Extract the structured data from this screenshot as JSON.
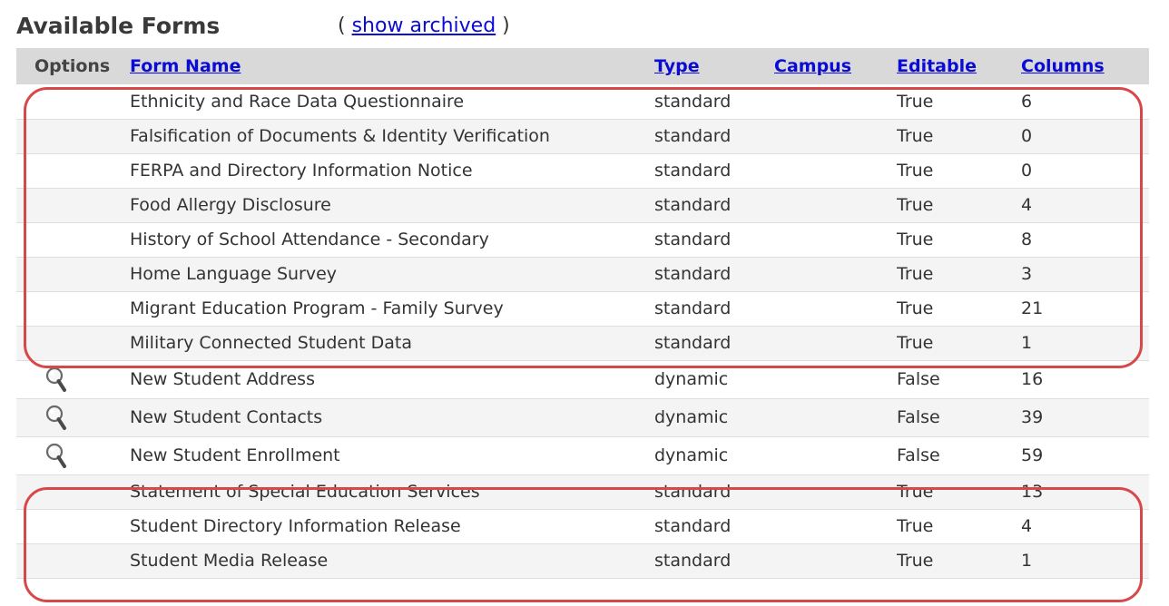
{
  "header": {
    "title": "Available Forms",
    "archived_open": "(",
    "archived_link": "show archived",
    "archived_close": ")"
  },
  "columns": [
    "Options",
    "Form Name",
    "Type",
    "Campus",
    "Editable",
    "Columns"
  ],
  "rows": [
    {
      "name": "Ethnicity and Race Data Questionnaire",
      "type": "standard",
      "campus": "",
      "editable": "True",
      "columns": "6",
      "icon": ""
    },
    {
      "name": "Falsification of Documents & Identity Verification",
      "type": "standard",
      "campus": "",
      "editable": "True",
      "columns": "0",
      "icon": ""
    },
    {
      "name": "FERPA and Directory Information Notice",
      "type": "standard",
      "campus": "",
      "editable": "True",
      "columns": "0",
      "icon": ""
    },
    {
      "name": "Food Allergy Disclosure",
      "type": "standard",
      "campus": "",
      "editable": "True",
      "columns": "4",
      "icon": ""
    },
    {
      "name": "History of School Attendance - Secondary",
      "type": "standard",
      "campus": "",
      "editable": "True",
      "columns": "8",
      "icon": ""
    },
    {
      "name": "Home Language Survey",
      "type": "standard",
      "campus": "",
      "editable": "True",
      "columns": "3",
      "icon": ""
    },
    {
      "name": "Migrant Education Program - Family Survey",
      "type": "standard",
      "campus": "",
      "editable": "True",
      "columns": "21",
      "icon": ""
    },
    {
      "name": "Military Connected Student Data",
      "type": "standard",
      "campus": "",
      "editable": "True",
      "columns": "1",
      "icon": ""
    },
    {
      "name": "New Student Address",
      "type": "dynamic",
      "campus": "",
      "editable": "False",
      "columns": "16",
      "icon": "magnifier-icon"
    },
    {
      "name": "New Student Contacts",
      "type": "dynamic",
      "campus": "",
      "editable": "False",
      "columns": "39",
      "icon": "magnifier-icon"
    },
    {
      "name": "New Student Enrollment",
      "type": "dynamic",
      "campus": "",
      "editable": "False",
      "columns": "59",
      "icon": "magnifier-icon"
    },
    {
      "name": "Statement of Special Education Services",
      "type": "standard",
      "campus": "",
      "editable": "True",
      "columns": "13",
      "icon": ""
    },
    {
      "name": "Student Directory Information Release",
      "type": "standard",
      "campus": "",
      "editable": "True",
      "columns": "4",
      "icon": ""
    },
    {
      "name": "Student Media Release",
      "type": "standard",
      "campus": "",
      "editable": "True",
      "columns": "1",
      "icon": ""
    }
  ],
  "colors": {
    "link": "#0b0bd6",
    "header_bg": "#d9d9d9",
    "annotation": "#d8484b"
  }
}
